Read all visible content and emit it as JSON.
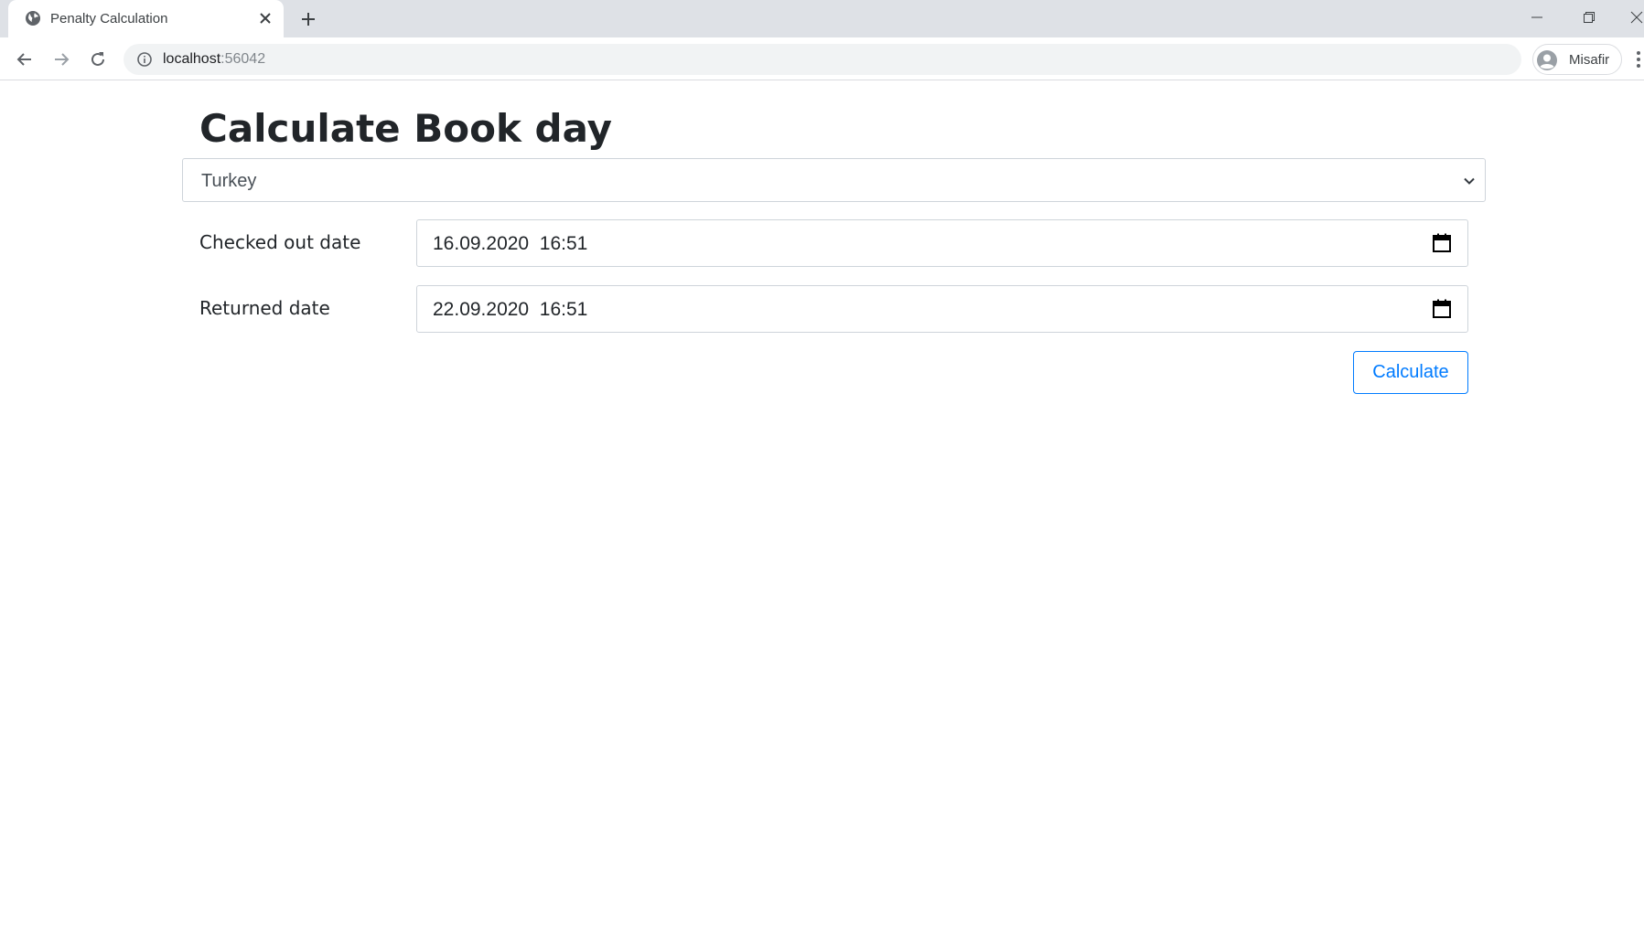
{
  "browser": {
    "tab": {
      "title": "Penalty Calculation",
      "favicon": "globe-icon"
    },
    "address": {
      "host": "localhost",
      "port": ":56042"
    },
    "profile": {
      "name": "Misafir"
    }
  },
  "page": {
    "title": "Calculate Book day",
    "country_select": {
      "selected": "Turkey"
    },
    "fields": {
      "checked_out": {
        "label": "Checked out date",
        "value": "16.09.2020  16:51"
      },
      "returned": {
        "label": "Returned date",
        "value": "22.09.2020  16:51"
      }
    },
    "calculate_button": "Calculate"
  },
  "colors": {
    "primary": "#007bff",
    "tabbar": "#dee1e6",
    "omnibox": "#f1f3f4",
    "input_border": "#ced4da"
  }
}
